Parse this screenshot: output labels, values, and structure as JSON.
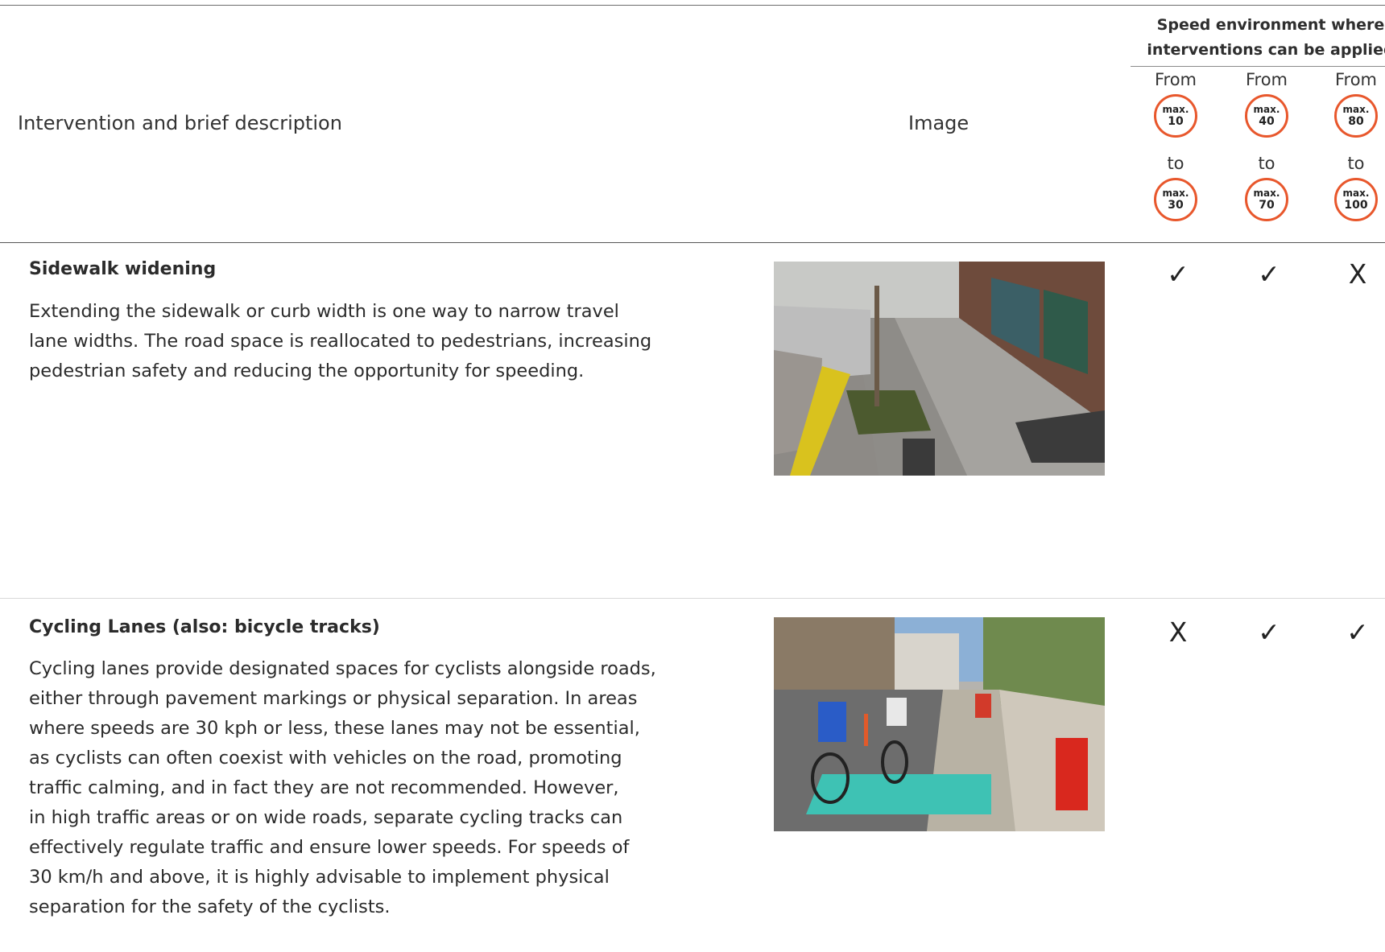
{
  "header": {
    "description_label": "Intervention and brief description",
    "image_label": "Image",
    "speed_title_line1": "Speed environment where",
    "speed_title_line2": "interventions can be applied",
    "from_word": "From",
    "to_word": "to",
    "columns": [
      {
        "from_prefix": "max.",
        "from_value": "10",
        "to_prefix": "max.",
        "to_value": "30"
      },
      {
        "from_prefix": "max.",
        "from_value": "40",
        "to_prefix": "max.",
        "to_value": "70"
      },
      {
        "from_prefix": "max.",
        "from_value": "80",
        "to_prefix": "max.",
        "to_value": "100"
      }
    ]
  },
  "rows": [
    {
      "title": "Sidewalk widening",
      "lines": [
        "Extending the sidewalk or curb width is one way to narrow travel",
        "lane widths. The road space is reallocated to pedestrians, increasing",
        "pedestrian safety and reducing the opportunity for speeding."
      ],
      "marks": [
        "✓",
        "✓",
        "X"
      ]
    },
    {
      "title": "Cycling Lanes (also: bicycle tracks)",
      "lines": [
        "Cycling lanes provide designated spaces for cyclists alongside roads,",
        "either through pavement markings or physical separation. In areas",
        "where speeds are 30 kph or less, these lanes may not be essential,",
        "as cyclists can often coexist with vehicles on the road, promoting",
        "traffic calming, and in fact they are not recommended. However,",
        "in high traffic areas or on wide roads, separate cycling tracks can",
        "effectively regulate traffic and ensure lower speeds. For speeds of",
        "30 km/h and above, it is highly advisable to implement physical",
        "separation for the safety of the cyclists."
      ],
      "marks": [
        "X",
        "✓",
        "✓"
      ]
    }
  ],
  "colors": {
    "badge_ring": "#e8572c",
    "text": "#2b2b2b"
  }
}
